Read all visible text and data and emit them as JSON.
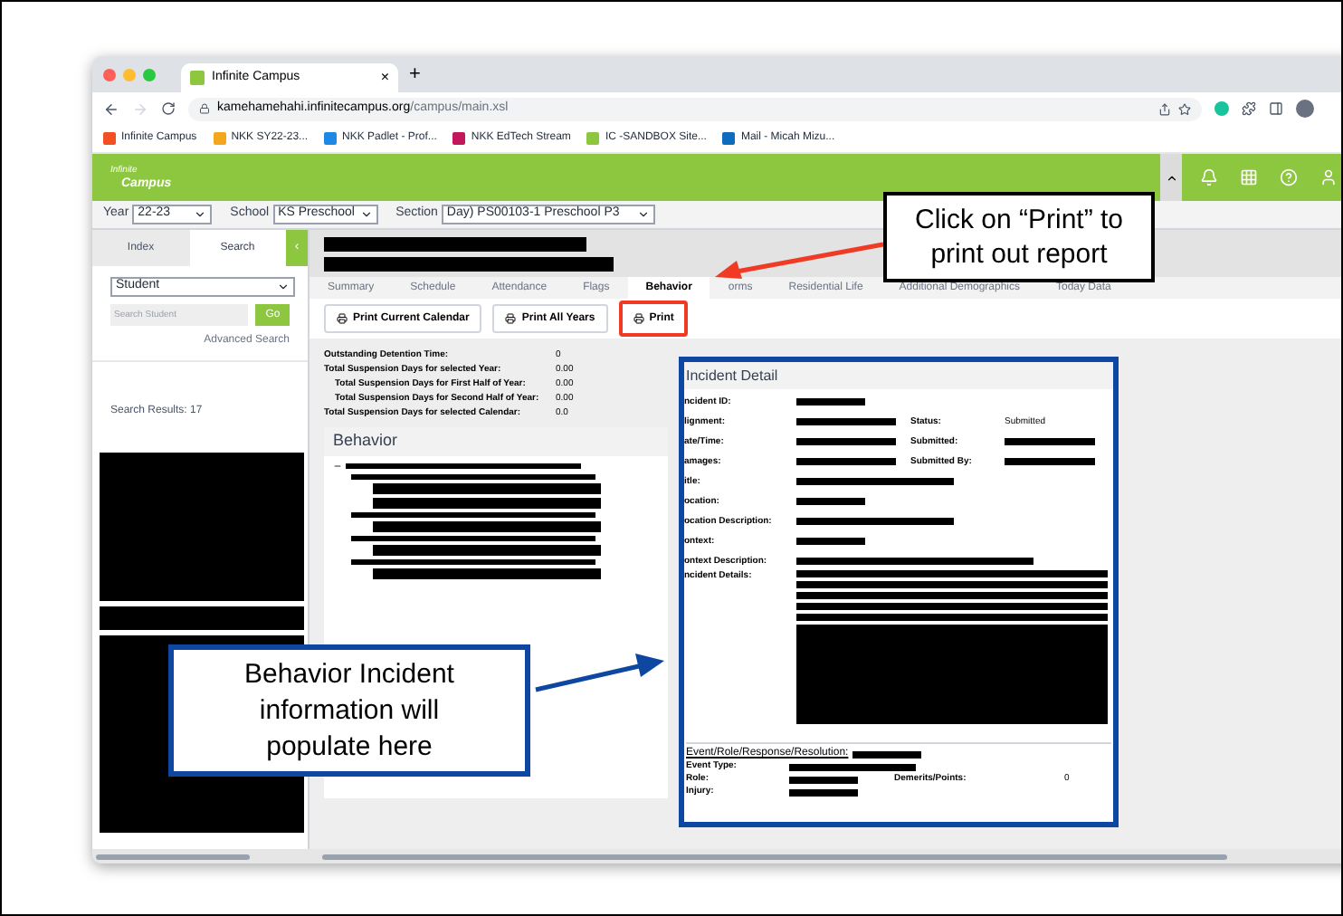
{
  "browser": {
    "tab_title": "Infinite Campus",
    "tab_close": "×",
    "new_tab": "+",
    "url_host": "kamehamehahi.infinitecampus.org",
    "url_path": "/campus/main.xsl",
    "bookmarks": [
      {
        "label": "Infinite Campus",
        "color": "#f25022"
      },
      {
        "label": "NKK SY22-23...",
        "color": "#f4a61c"
      },
      {
        "label": "NKK Padlet - Prof...",
        "color": "#1e88e5"
      },
      {
        "label": "NKK EdTech Stream",
        "color": "#c2185b"
      },
      {
        "label": "IC -SANDBOX Site...",
        "color": "#8dc63f"
      },
      {
        "label": "Mail - Micah Mizu...",
        "color": "#0f6cbd"
      }
    ]
  },
  "app": {
    "logo_top": "Infinite",
    "logo_bottom": "Campus",
    "filters": [
      {
        "label": "Year",
        "value": "22-23"
      },
      {
        "label": "School",
        "value": "KS Preschool"
      },
      {
        "label": "Section",
        "value": "Day) PS00103-1 Preschool P3"
      }
    ]
  },
  "sidebar": {
    "tabs": [
      {
        "label": "Index",
        "selected": false
      },
      {
        "label": "Search",
        "selected": true
      }
    ],
    "collapse": "‹",
    "search_type": "Student",
    "search_placeholder": "Search Student",
    "go": "Go",
    "advanced": "Advanced Search",
    "results": "Search Results: 17"
  },
  "student_tabs": [
    {
      "label": "Summary",
      "selected": false
    },
    {
      "label": "Schedule",
      "selected": false
    },
    {
      "label": "Attendance",
      "selected": false
    },
    {
      "label": "Flags",
      "selected": false
    },
    {
      "label": "Behavior",
      "selected": true
    },
    {
      "label": "orms",
      "selected": false
    },
    {
      "label": "Residential Life",
      "selected": false
    },
    {
      "label": "Additional Demographics",
      "selected": false
    },
    {
      "label": "Today Data",
      "selected": false
    }
  ],
  "actions": [
    {
      "label": "Print Current Calendar",
      "highlighted": false
    },
    {
      "label": "Print All Years",
      "highlighted": false
    },
    {
      "label": "Print",
      "highlighted": true
    }
  ],
  "stats": [
    {
      "label": "Outstanding Detention Time:",
      "value": "0",
      "indented": false
    },
    {
      "label": "Total Suspension Days for selected Year:",
      "value": "0.00",
      "indented": false
    },
    {
      "label": "Total Suspension Days for First Half of Year:",
      "value": "0.00",
      "indented": true
    },
    {
      "label": "Total Suspension Days for Second Half of Year:",
      "value": "0.00",
      "indented": true
    },
    {
      "label": "Total Suspension Days for selected Calendar:",
      "value": "0.0",
      "indented": false
    }
  ],
  "behavior": {
    "title": "Behavior"
  },
  "incident": {
    "title": "Incident Detail",
    "rows": [
      {
        "kind": "single",
        "label": "ncident ID:"
      },
      {
        "kind": "pair",
        "label": "lignment:",
        "extra_label": "Status:",
        "extra_value": "Submitted"
      },
      {
        "kind": "pair",
        "label": "ate/Time:",
        "extra_label": "Submitted:"
      },
      {
        "kind": "pair",
        "label": "amages:",
        "extra_label": "Submitted By:"
      },
      {
        "kind": "single",
        "label": "itle:"
      },
      {
        "kind": "single",
        "label": "ocation:"
      },
      {
        "kind": "single",
        "label": "ocation Description:"
      },
      {
        "kind": "single",
        "label": "ontext:"
      },
      {
        "kind": "single",
        "label": "ontext Description:"
      },
      {
        "kind": "details",
        "label": "ncident Details:"
      }
    ],
    "event_title": "Event/Role/Response/Resolution:",
    "event_type": "Event Type:",
    "role": "Role:",
    "demerits": "Demerits/Points:",
    "demerits_value": "0",
    "injury": "Injury:"
  },
  "callouts": [
    {
      "kind": "print",
      "text": "Click on “Print” to print out report"
    },
    {
      "kind": "incident",
      "text": "Behavior Incident information will populate here"
    }
  ]
}
